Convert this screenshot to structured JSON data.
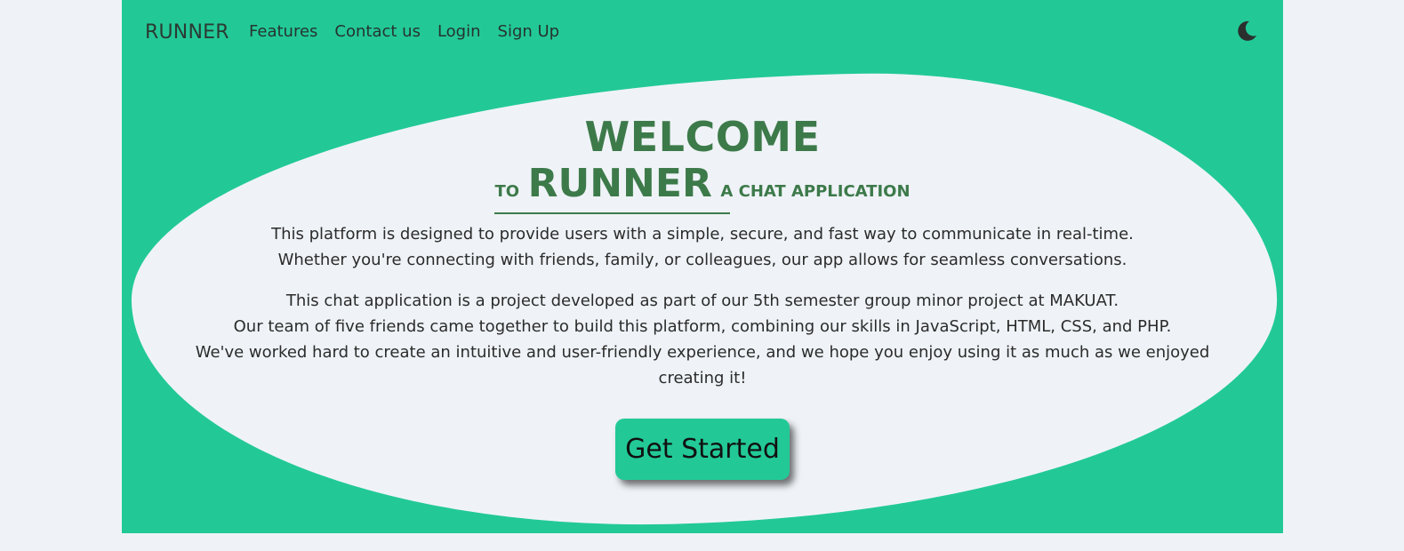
{
  "nav": {
    "brand": "RUNNER",
    "links": [
      "Features",
      "Contact us",
      "Login",
      "Sign Up"
    ],
    "theme_icon": "moon-icon"
  },
  "hero": {
    "welcome": "WELCOME",
    "to": "TO",
    "runner": "RUNNER",
    "tagline": "A CHAT APPLICATION",
    "intro_lines": [
      "This platform is designed to provide users with a simple, secure, and fast way to communicate in real-time.",
      "Whether you're connecting with friends, family, or colleagues, our app allows for seamless conversations."
    ],
    "project_lines": [
      "This chat application is a project developed as part of our 5th semester group minor project at MAKUAT.",
      "Our team of five friends came together to build this platform, combining our skills in JavaScript, HTML, CSS, and PHP.",
      "We've worked hard to create an intuitive and user-friendly experience, and we hope you enjoy using it as much as we enjoyed creating it!"
    ],
    "cta_label": "Get Started"
  },
  "colors": {
    "accent": "#22c997",
    "heading": "#3d7a4a",
    "background": "#eff3f7"
  }
}
